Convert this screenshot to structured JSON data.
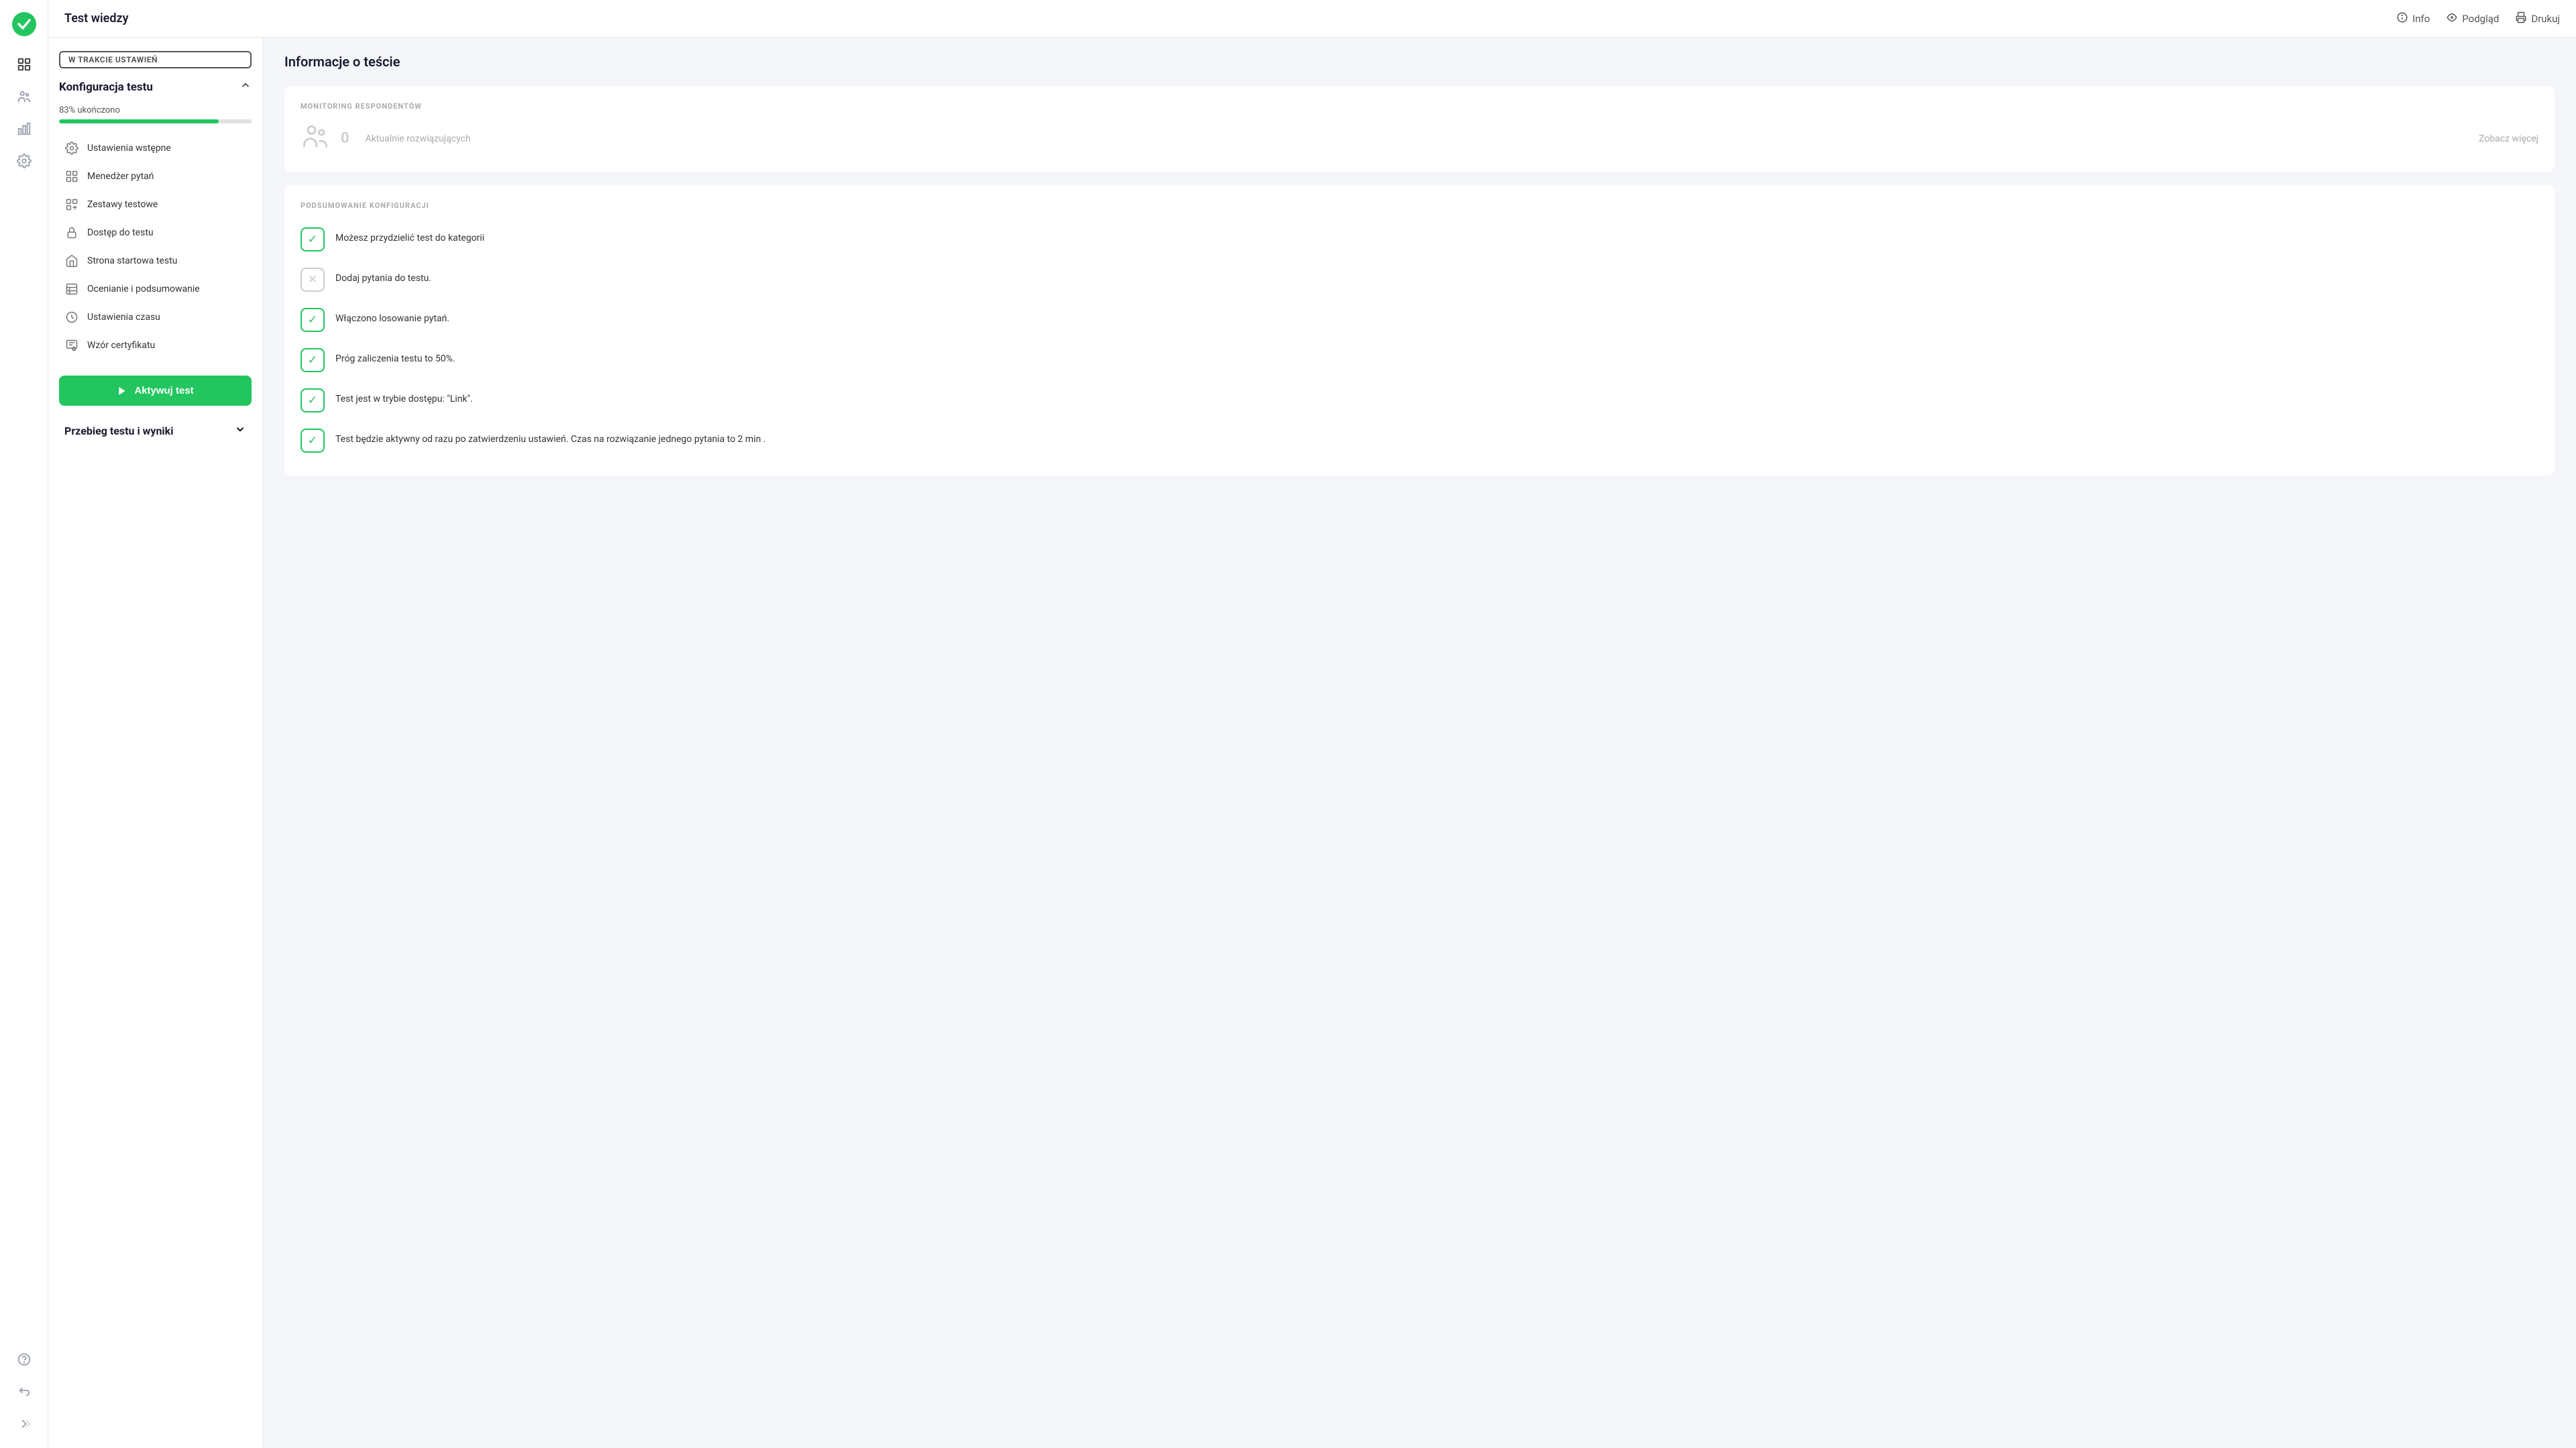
{
  "app": {
    "logo_label": "Logo"
  },
  "topbar": {
    "title": "Test wiedzy",
    "actions": [
      {
        "key": "info",
        "label": "Info",
        "icon": "info-icon"
      },
      {
        "key": "preview",
        "label": "Podgląd",
        "icon": "eye-icon"
      },
      {
        "key": "print",
        "label": "Drukuj",
        "icon": "print-icon"
      }
    ]
  },
  "left_panel": {
    "status_badge": "W TRAKCIE USTAWIEŃ",
    "config_title": "Konfiguracja testu",
    "progress_label": "83% ukończono",
    "progress_value": 83,
    "menu_items": [
      {
        "key": "initial-settings",
        "label": "Ustawienia wstępne",
        "icon": "settings-icon"
      },
      {
        "key": "question-manager",
        "label": "Menedżer pytań",
        "icon": "questions-icon"
      },
      {
        "key": "test-sets",
        "label": "Zestawy testowe",
        "icon": "sets-icon"
      },
      {
        "key": "access",
        "label": "Dostęp do testu",
        "icon": "lock-icon"
      },
      {
        "key": "start-page",
        "label": "Strona startowa testu",
        "icon": "home-icon"
      },
      {
        "key": "grading",
        "label": "Ocenianie i podsumowanie",
        "icon": "grading-icon"
      },
      {
        "key": "time-settings",
        "label": "Ustawienia czasu",
        "icon": "clock-icon"
      },
      {
        "key": "certificate",
        "label": "Wzór certyfikatu",
        "icon": "certificate-icon"
      }
    ],
    "activate_btn_label": "Aktywuj test",
    "section2_title": "Przebieg testu i wyniki"
  },
  "right_panel": {
    "title": "Informacje o teście",
    "monitoring_section": {
      "label": "MONITORING RESPONDENTÓW",
      "count": "0",
      "description": "Aktualnie rozwiązujących",
      "see_more": "Zobacz więcej"
    },
    "config_summary": {
      "label": "PODSUMOWANIE KONFIGURACJI",
      "items": [
        {
          "key": "category",
          "status": "check",
          "text": "Możesz przydzielić test do kategorii"
        },
        {
          "key": "questions",
          "status": "cross",
          "text": "Dodaj pytania do testu."
        },
        {
          "key": "randomize",
          "status": "check",
          "text": "Włączono losowanie pytań."
        },
        {
          "key": "threshold",
          "status": "check",
          "text": "Próg zaliczenia testu to 50%."
        },
        {
          "key": "access-mode",
          "status": "check",
          "text": "Test jest w trybie dostępu: \"Link\"."
        },
        {
          "key": "timing",
          "status": "check",
          "text": "Test będzie aktywny od razu po zatwierdzeniu ustawień. Czas na rozwiązanie jednego pytania to 2 min ."
        }
      ]
    }
  },
  "sidebar_icons": [
    {
      "key": "home",
      "icon": "home-icon"
    },
    {
      "key": "grid",
      "icon": "grid-icon"
    },
    {
      "key": "users",
      "icon": "users-icon"
    },
    {
      "key": "chart",
      "icon": "chart-icon"
    },
    {
      "key": "gear",
      "icon": "gear-icon"
    }
  ],
  "sidebar_bottom_icons": [
    {
      "key": "help",
      "icon": "help-icon"
    },
    {
      "key": "back",
      "icon": "back-icon"
    },
    {
      "key": "expand",
      "icon": "expand-icon"
    }
  ]
}
